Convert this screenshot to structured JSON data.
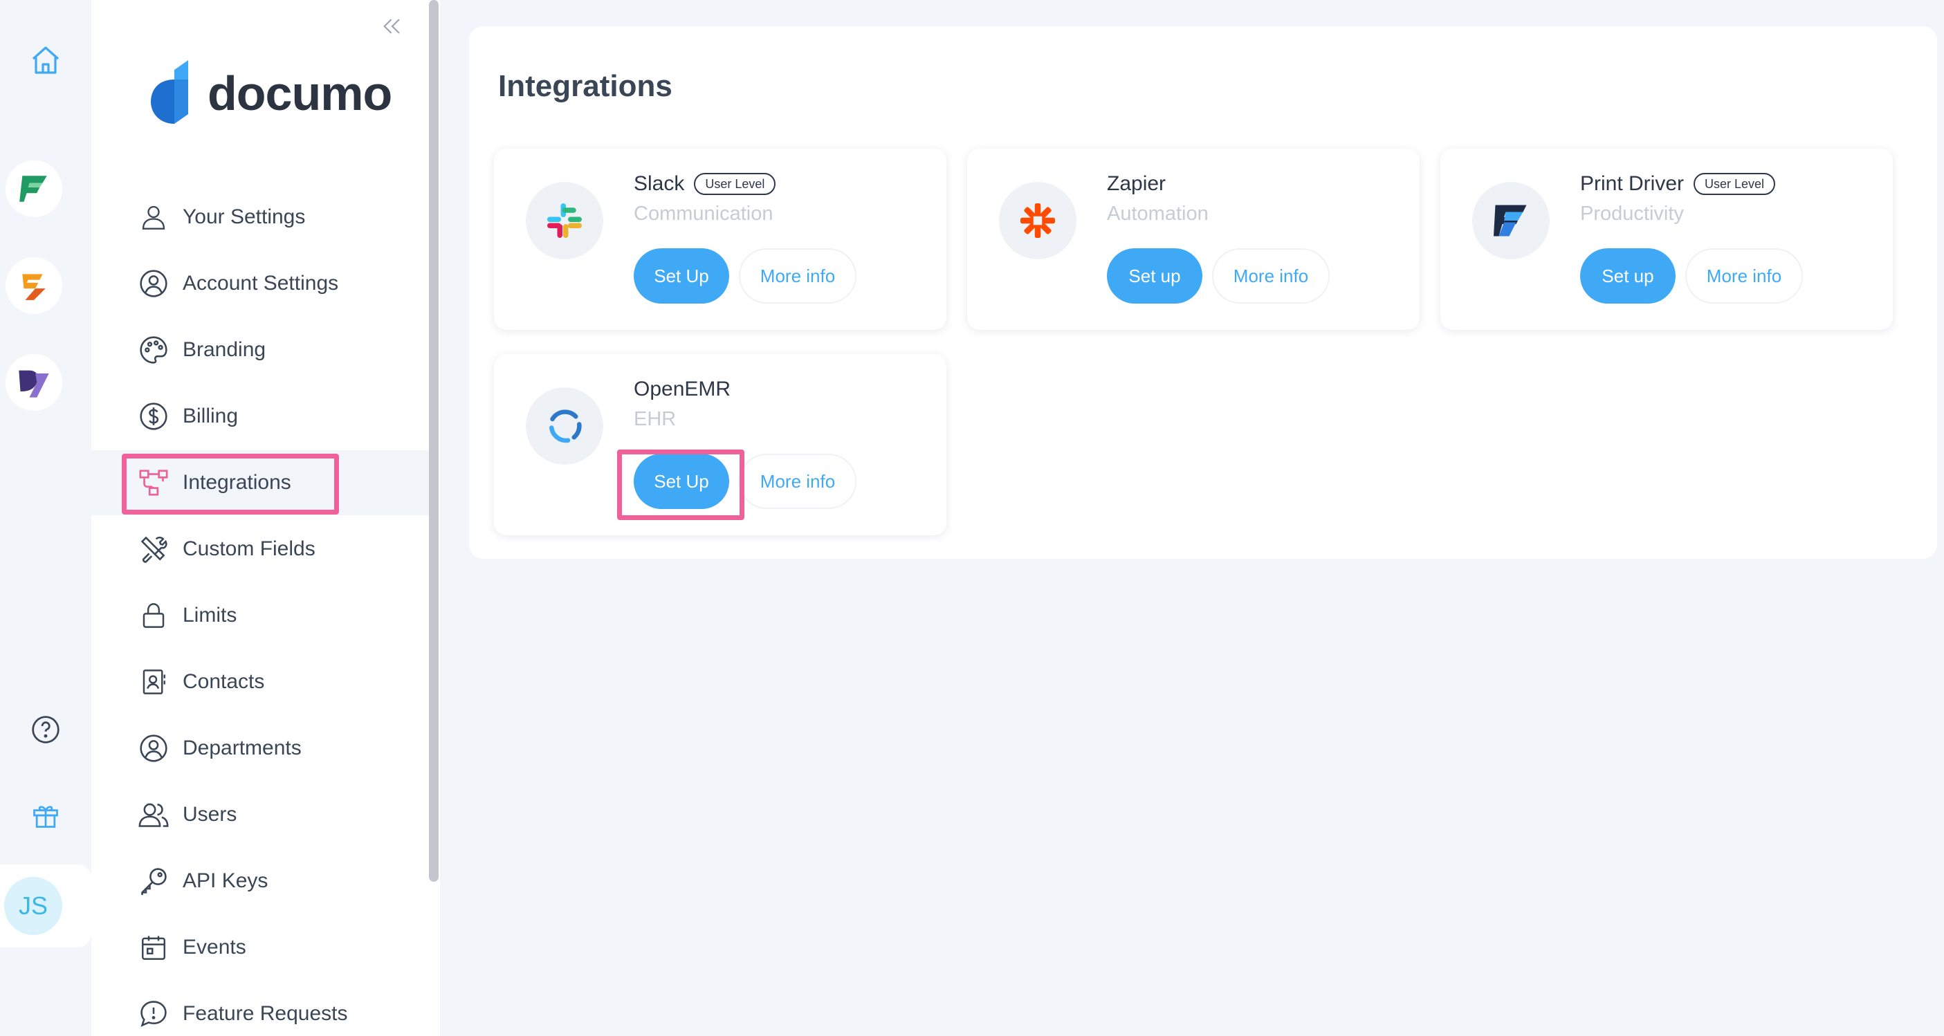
{
  "brand": {
    "name": "documo"
  },
  "rail": {
    "avatar_initials": "JS"
  },
  "sidebar": {
    "items": [
      {
        "label": "Your Settings",
        "icon": "user-icon"
      },
      {
        "label": "Account Settings",
        "icon": "user-circle-icon"
      },
      {
        "label": "Branding",
        "icon": "palette-icon"
      },
      {
        "label": "Billing",
        "icon": "dollar-icon"
      },
      {
        "label": "Integrations",
        "icon": "integrations-icon",
        "active": true
      },
      {
        "label": "Custom Fields",
        "icon": "tools-icon"
      },
      {
        "label": "Limits",
        "icon": "lock-icon"
      },
      {
        "label": "Contacts",
        "icon": "contacts-icon"
      },
      {
        "label": "Departments",
        "icon": "user-circle-icon"
      },
      {
        "label": "Users",
        "icon": "users-icon"
      },
      {
        "label": "API Keys",
        "icon": "key-icon"
      },
      {
        "label": "Events",
        "icon": "calendar-icon"
      },
      {
        "label": "Feature Requests",
        "icon": "chat-icon"
      }
    ]
  },
  "main": {
    "title": "Integrations",
    "cards": [
      {
        "name": "Slack",
        "badge": "User Level",
        "category": "Communication",
        "setup_label": "Set Up",
        "more_label": "More info"
      },
      {
        "name": "Zapier",
        "badge": "",
        "category": "Automation",
        "setup_label": "Set up",
        "more_label": "More info"
      },
      {
        "name": "Print Driver",
        "badge": "User Level",
        "category": "Productivity",
        "setup_label": "Set up",
        "more_label": "More info"
      },
      {
        "name": "OpenEMR",
        "badge": "",
        "category": "EHR",
        "setup_label": "Set Up",
        "more_label": "More info"
      }
    ]
  },
  "colors": {
    "accent": "#3fa9f5",
    "highlight": "#f0619a",
    "background": "#f2f5fa"
  }
}
